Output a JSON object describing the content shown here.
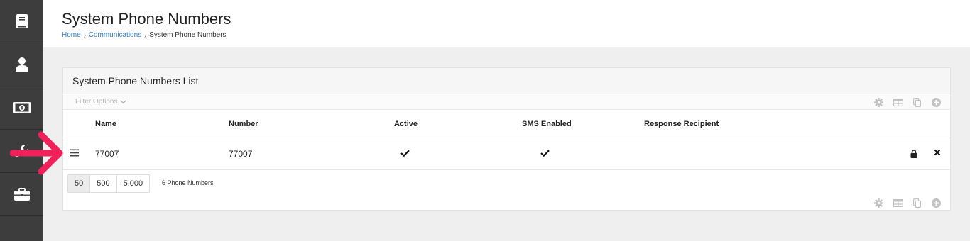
{
  "sidebar": {
    "items": [
      {
        "icon": "book-icon"
      },
      {
        "icon": "user-icon"
      },
      {
        "icon": "money-icon"
      },
      {
        "icon": "wrench-icon"
      },
      {
        "icon": "briefcase-icon"
      }
    ]
  },
  "header": {
    "title": "System Phone Numbers",
    "breadcrumb": [
      "Home",
      "Communications",
      "System Phone Numbers"
    ]
  },
  "panel": {
    "title": "System Phone Numbers List",
    "filter_label": "Filter Options",
    "columns": [
      "Name",
      "Number",
      "Active",
      "SMS Enabled",
      "Response Recipient"
    ],
    "rows": [
      {
        "name": "77007",
        "number": "77007",
        "active": true,
        "sms_enabled": true,
        "response_recipient": ""
      }
    ],
    "page_sizes": [
      "50",
      "500",
      "5,000"
    ],
    "selected_page_size": "50",
    "count_label": "6 Phone Numbers"
  },
  "colors": {
    "sidebar_bg": "#3d3d3d",
    "link": "#2f7bbf",
    "annotation_arrow": "#f0215a"
  }
}
